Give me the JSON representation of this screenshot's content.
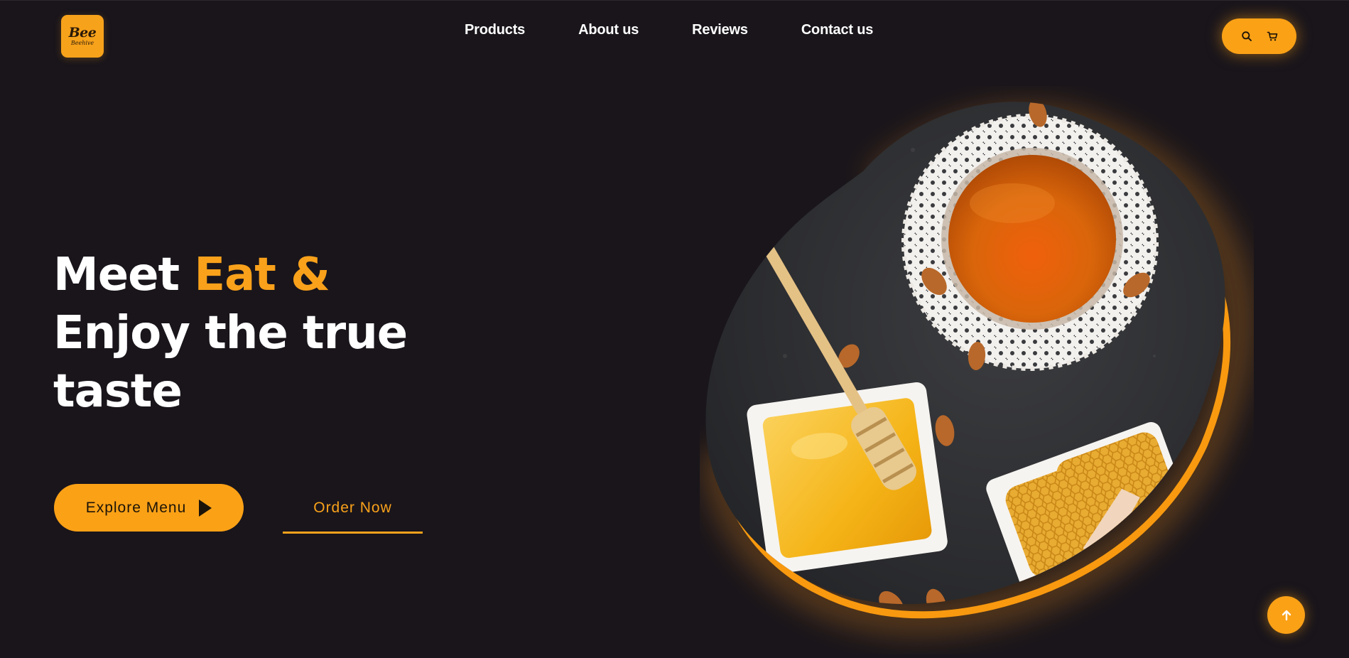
{
  "logo": {
    "script": "Bee",
    "subtitle": "Beehive"
  },
  "nav": {
    "products": "Products",
    "about": "About us",
    "reviews": "Reviews",
    "contact": "Contact us"
  },
  "header_actions": {
    "icons": [
      "search-icon",
      "cart-icon"
    ]
  },
  "hero": {
    "line1_white": "Meet ",
    "line1_accent": "Eat &",
    "line2": "Enjoy the true",
    "line3": "taste",
    "explore_label": "Explore Menu",
    "order_label": "Order Now"
  },
  "colors": {
    "background": "#19151b",
    "accent": "#fba116",
    "text": "#ffffff"
  }
}
